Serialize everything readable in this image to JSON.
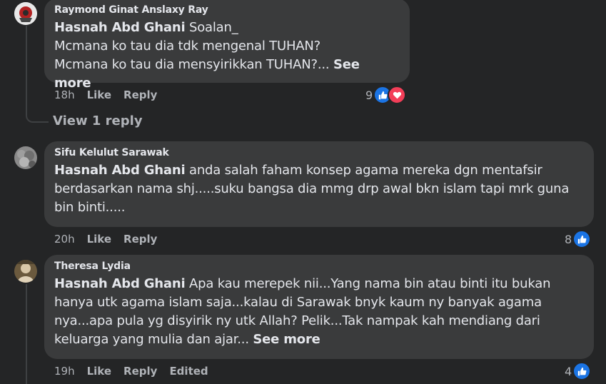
{
  "comments": [
    {
      "author": "Raymond Ginat Anslaxy Ray",
      "mention": "Hasnah Abd Ghani",
      "lines": [
        "Soalan_",
        "Mcmana ko tau dia tdk mengenal TUHAN?",
        "Mcmana ko tau dia mensyirikkan TUHAN?..."
      ],
      "see_more": "See more",
      "time": "18h",
      "like": "Like",
      "reply": "Reply",
      "reaction_count": "9",
      "reactions": [
        "like-icon",
        "love-icon"
      ]
    },
    {
      "author": "Sifu Kelulut Sarawak",
      "mention": "Hasnah Abd Ghani",
      "lines": [
        "anda salah faham konsep agama mereka dgn mentafsir",
        "berdasarkan nama shj.....suku bangsa dia mmg drp awal bkn islam tapi mrk guna",
        "bin binti....."
      ],
      "time": "20h",
      "like": "Like",
      "reply": "Reply",
      "reaction_count": "8",
      "reactions": [
        "like-icon"
      ]
    },
    {
      "author": "Theresa Lydia",
      "mention": "Hasnah Abd Ghani",
      "lines": [
        "Apa kau merepek nii...Yang nama bin atau binti itu bukan",
        "hanya utk agama islam saja...kalau di Sarawak bnyk kaum ny banyak agama",
        "nya...apa pula yg disyirik ny utk Allah? Pelik...Tak nampak kah mendiang dari",
        "keluarga yang mulia dan ajar..."
      ],
      "see_more": "See more",
      "time": "19h",
      "like": "Like",
      "reply": "Reply",
      "edited": "Edited",
      "reaction_count": "4",
      "reactions": [
        "like-icon"
      ]
    }
  ],
  "view_replies": "View 1 reply",
  "colors": {
    "background": "#242526",
    "bubble": "#3a3b3c",
    "text": "#e4e6eb",
    "secondary": "#b0b3b8",
    "like": "#1b74e4",
    "love": "#f33e58"
  }
}
